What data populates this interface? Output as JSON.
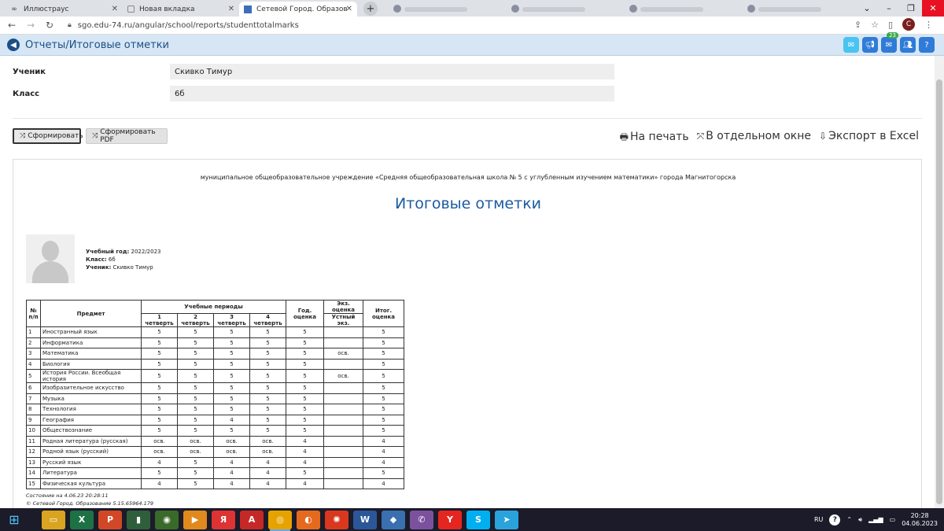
{
  "browser": {
    "tabs": [
      {
        "title": "Иллюстраус",
        "icon": "infinity-icon"
      },
      {
        "title": "Новая вкладка",
        "icon": "blank-tab-icon"
      },
      {
        "title": "Сетевой Город. Образование. С",
        "icon": "school-favicon",
        "active": true
      }
    ],
    "close_glyph": "✕",
    "new_tab_glyph": "+",
    "url": "sgo.edu-74.ru/angular/school/reports/studenttotalmarks",
    "profile_initial": "С"
  },
  "app": {
    "title": "Отчеты/Итоговые отметки",
    "mail_badge": "23",
    "help_label": "?"
  },
  "form": {
    "student_label": "Ученик",
    "student_value": "Скивко Тимур",
    "class_label": "Класс",
    "class_value": "6б"
  },
  "actions": {
    "generate": "Сформировать",
    "generate_pdf": "Сформировать PDF",
    "print": "На печать",
    "separate_window": "В отдельном окне",
    "export_excel": "Экспорт в Excel"
  },
  "report": {
    "school": "муниципальное общеобразовательное учреждение «Средняя общеобразовательная школа № 5 с углубленным изучением математики» города Магнитогорска",
    "title": "Итоговые отметки",
    "year_label": "Учебный год:",
    "year_value": "2022/2023",
    "class_label": "Класс:",
    "class_value": "6б",
    "student_label": "Ученик:",
    "student_value": "Скивко Тимур",
    "headers": {
      "num": "№ п/п",
      "subject": "Предмет",
      "periods": "Учебные периоды",
      "q1": "1 четверть",
      "q2": "2 четверть",
      "q3": "3 четверть",
      "q4": "4 четверть",
      "year": "Год. оценка",
      "exam": "Экз. оценка",
      "oral": "Устный экз.",
      "final": "Итог. оценка"
    },
    "rows": [
      {
        "n": "1",
        "subject": "Иностранный язык",
        "q1": "5",
        "q2": "5",
        "q3": "5",
        "q4": "5",
        "year": "5",
        "oral": "",
        "final": "5"
      },
      {
        "n": "2",
        "subject": "Информатика",
        "q1": "5",
        "q2": "5",
        "q3": "5",
        "q4": "5",
        "year": "5",
        "oral": "",
        "final": "5"
      },
      {
        "n": "3",
        "subject": "Математика",
        "q1": "5",
        "q2": "5",
        "q3": "5",
        "q4": "5",
        "year": "5",
        "oral": "осв.",
        "final": "5"
      },
      {
        "n": "4",
        "subject": "Биология",
        "q1": "5",
        "q2": "5",
        "q3": "5",
        "q4": "5",
        "year": "5",
        "oral": "",
        "final": "5"
      },
      {
        "n": "5",
        "subject": "История России. Всеобщая история",
        "q1": "5",
        "q2": "5",
        "q3": "5",
        "q4": "5",
        "year": "5",
        "oral": "осв.",
        "final": "5"
      },
      {
        "n": "6",
        "subject": "Изобразительное искусство",
        "q1": "5",
        "q2": "5",
        "q3": "5",
        "q4": "5",
        "year": "5",
        "oral": "",
        "final": "5"
      },
      {
        "n": "7",
        "subject": "Музыка",
        "q1": "5",
        "q2": "5",
        "q3": "5",
        "q4": "5",
        "year": "5",
        "oral": "",
        "final": "5"
      },
      {
        "n": "8",
        "subject": "Технология",
        "q1": "5",
        "q2": "5",
        "q3": "5",
        "q4": "5",
        "year": "5",
        "oral": "",
        "final": "5"
      },
      {
        "n": "9",
        "subject": "География",
        "q1": "5",
        "q2": "5",
        "q3": "4",
        "q4": "5",
        "year": "5",
        "oral": "",
        "final": "5"
      },
      {
        "n": "10",
        "subject": "Обществознание",
        "q1": "5",
        "q2": "5",
        "q3": "5",
        "q4": "5",
        "year": "5",
        "oral": "",
        "final": "5"
      },
      {
        "n": "11",
        "subject": "Родная литература (русская)",
        "q1": "осв.",
        "q2": "осв.",
        "q3": "осв.",
        "q4": "осв.",
        "year": "4",
        "oral": "",
        "final": "4"
      },
      {
        "n": "12",
        "subject": "Родной язык (русский)",
        "q1": "осв.",
        "q2": "осв.",
        "q3": "осв.",
        "q4": "осв.",
        "year": "4",
        "oral": "",
        "final": "4"
      },
      {
        "n": "13",
        "subject": "Русский язык",
        "q1": "4",
        "q2": "5",
        "q3": "4",
        "q4": "4",
        "year": "4",
        "oral": "",
        "final": "4"
      },
      {
        "n": "14",
        "subject": "Литература",
        "q1": "5",
        "q2": "5",
        "q3": "4",
        "q4": "4",
        "year": "5",
        "oral": "",
        "final": "5"
      },
      {
        "n": "15",
        "subject": "Физическая культура",
        "q1": "4",
        "q2": "5",
        "q3": "4",
        "q4": "4",
        "year": "4",
        "oral": "",
        "final": "4"
      }
    ],
    "state": "Состояние на 4.06.23 20:28:11",
    "version": "© Сетевой Город. Образование 5.15.65964.179"
  },
  "taskbar": {
    "apps": [
      {
        "name": "file-explorer-app",
        "glyph": "▭",
        "color": "#d9a521"
      },
      {
        "name": "excel-app",
        "glyph": "X",
        "color": "#1e7145"
      },
      {
        "name": "powerpoint-app",
        "glyph": "P",
        "color": "#d24726"
      },
      {
        "name": "app-dark-green",
        "glyph": "▮",
        "color": "#2f5f3a"
      },
      {
        "name": "eye-app",
        "glyph": "◉",
        "color": "#3a6a2a"
      },
      {
        "name": "media-player-app",
        "glyph": "▶",
        "color": "#e08a1e"
      },
      {
        "name": "yandex-app",
        "glyph": "Я",
        "color": "#d33"
      },
      {
        "name": "pdf-app",
        "glyph": "A",
        "color": "#c62828"
      },
      {
        "name": "chrome-app",
        "glyph": "◎",
        "color": "#e6a300",
        "active": true
      },
      {
        "name": "firefox-app",
        "glyph": "◐",
        "color": "#e66a1e"
      },
      {
        "name": "film-app",
        "glyph": "✺",
        "color": "#d9381e"
      },
      {
        "name": "word-app",
        "glyph": "W",
        "color": "#2b579a"
      },
      {
        "name": "shield-app",
        "glyph": "◆",
        "color": "#3a6fb0"
      },
      {
        "name": "viber-app",
        "glyph": "✆",
        "color": "#7b519d"
      },
      {
        "name": "yandex-browser-app",
        "glyph": "Y",
        "color": "#e52620"
      },
      {
        "name": "skype-app",
        "glyph": "S",
        "color": "#00aff0"
      },
      {
        "name": "telegram-app",
        "glyph": "➤",
        "color": "#2aa3dd"
      }
    ],
    "lang": "RU",
    "time": "20:28",
    "date": "04.06.2023"
  }
}
